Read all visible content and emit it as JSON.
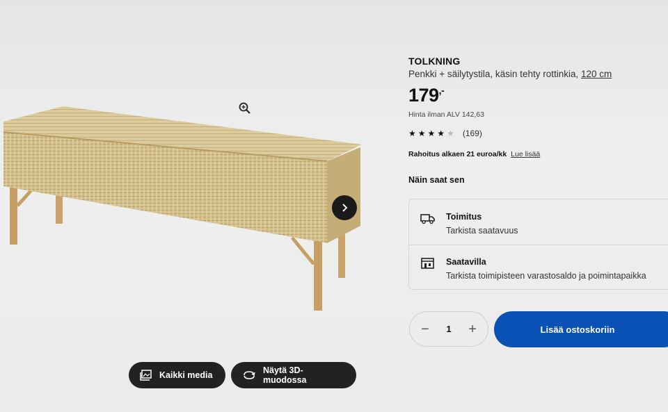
{
  "product": {
    "name": "TOLKNING",
    "description": "Penkki + säilytystila, käsin tehty rottinkia,",
    "size": "120 cm",
    "price": "179",
    "price_suffix": ",-",
    "vat_text": "Hinta ilman ALV 142,63",
    "rating": 4,
    "rating_max": 5,
    "review_count": "(169)",
    "finance_text": "Rahoitus alkaen 21 euroa/kk",
    "finance_link": "Lue lisää"
  },
  "availability": {
    "title": "Näin saat sen",
    "delivery": {
      "title": "Toimitus",
      "subtitle": "Tarkista saatavuus",
      "icon": "truck-icon"
    },
    "store": {
      "title": "Saatavilla",
      "subtitle": "Tarkista toimipisteen varastosaldo ja poimintapaikka",
      "icon": "store-icon"
    }
  },
  "purchase": {
    "quantity": "1",
    "minus": "−",
    "plus": "+",
    "add_to_cart": "Lisää ostoskoriin"
  },
  "media": {
    "all_media": "Kaikki media",
    "show_3d": "Näytä 3D-muodossa"
  },
  "colors": {
    "accent": "#0a51b5",
    "dark_button": "#222222"
  }
}
